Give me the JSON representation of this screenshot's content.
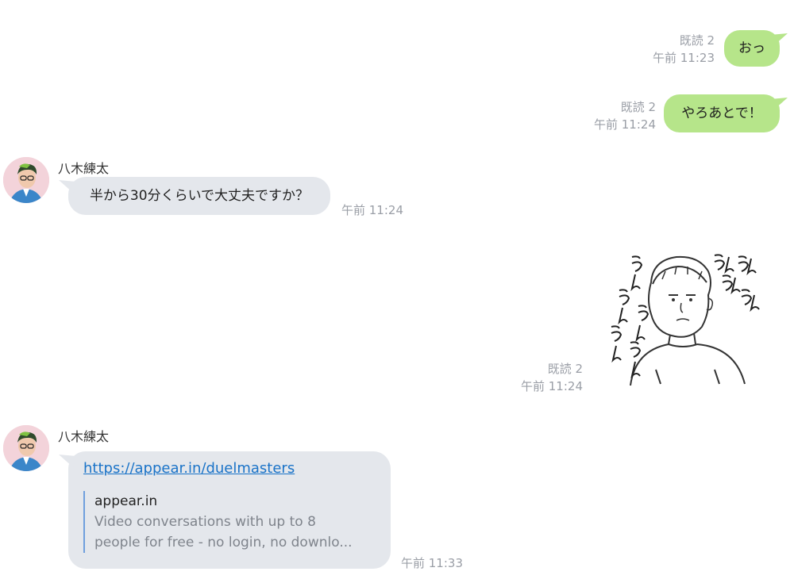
{
  "messages": {
    "m1": {
      "text": "おっ",
      "read": "既読 2",
      "time": "午前 11:23"
    },
    "m2": {
      "text": "やろあとで！",
      "read": "既読 2",
      "time": "午前 11:24"
    },
    "m3": {
      "sender": "八木練太",
      "text": "半から30分くらいで大丈夫ですか？",
      "time": "午前 11:24"
    },
    "m4": {
      "read": "既読 2",
      "time": "午前 11:24",
      "sticker_text": [
        "うんうん",
        "うんうん",
        "うんうんうん",
        "うんうん"
      ]
    },
    "m5": {
      "sender": "八木練太",
      "link": "https://appear.in/duelmasters",
      "preview_site": "appear.in",
      "preview_desc_line1": "Video conversations with up to 8",
      "preview_desc_line2": "people for free - no login, no downlo...",
      "time": "午前 11:33"
    }
  },
  "colors": {
    "own_bubble": "#b6e58a",
    "other_bubble": "#e4e7ec",
    "link": "#1a73c8",
    "meta": "#9a9ea6"
  }
}
